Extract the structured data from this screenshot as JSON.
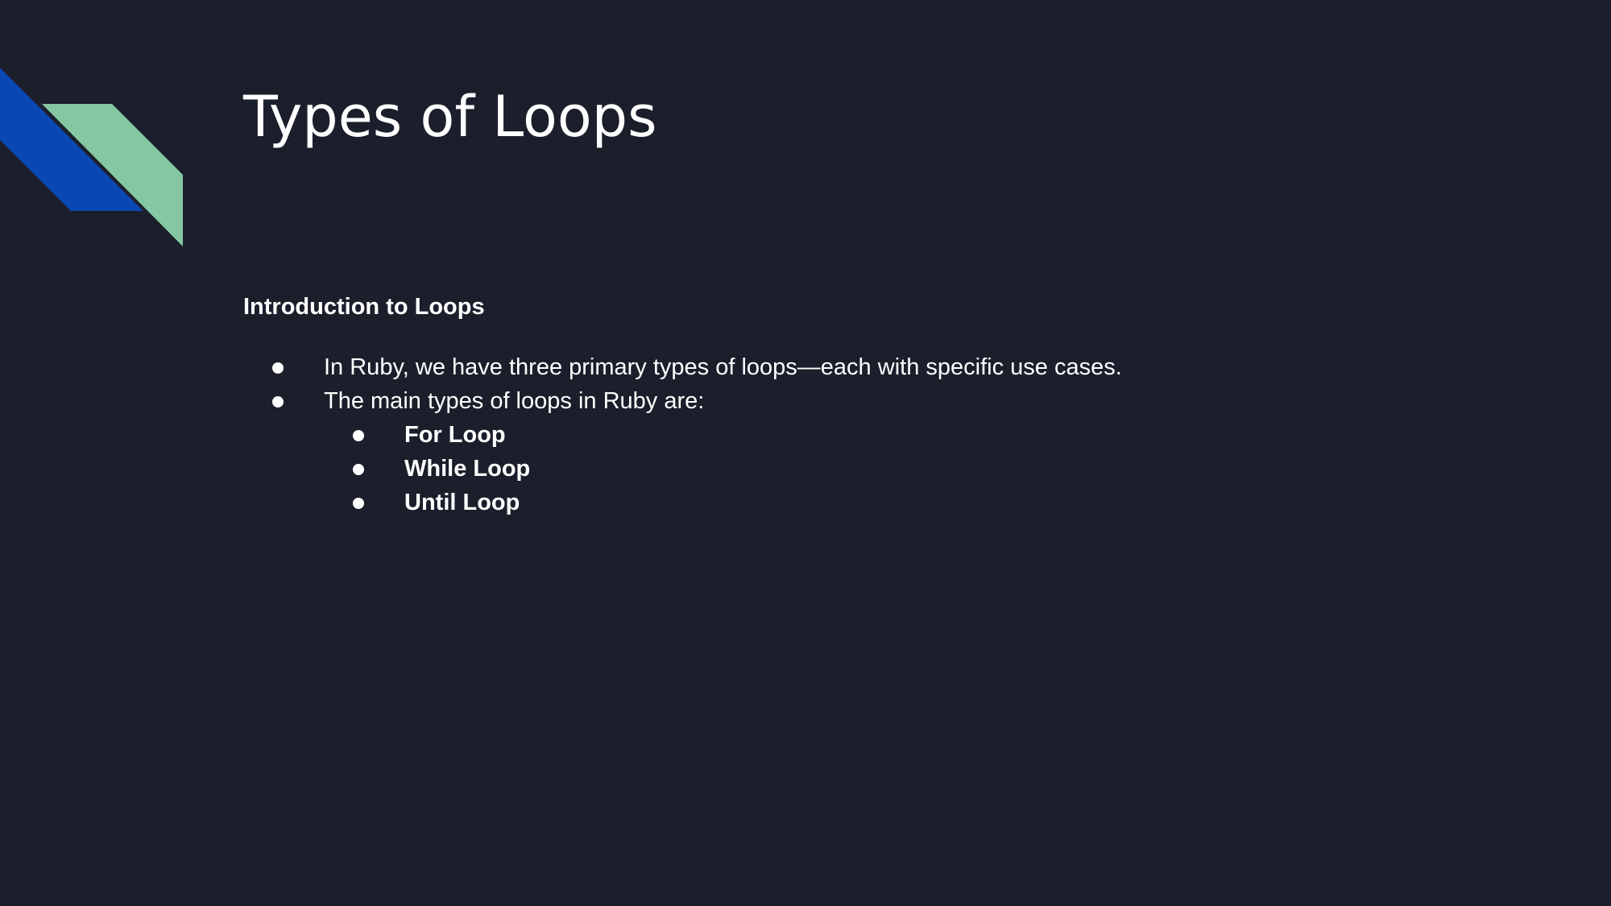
{
  "slide": {
    "title": "Types of Loops",
    "subtitle": "Introduction to Loops",
    "bullets": [
      "In Ruby, we have three primary types of loops—each with specific use cases.",
      "The main types of loops in Ruby are:"
    ],
    "sub_bullets": [
      "For Loop",
      "While Loop",
      "Until Loop"
    ]
  },
  "colors": {
    "background": "#1b1f2b",
    "accent_blue": "#0a47b3",
    "accent_green": "#86c7a3",
    "text": "#ffffff"
  }
}
